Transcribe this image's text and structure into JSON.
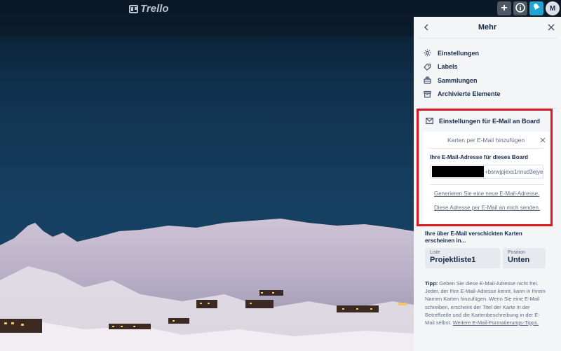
{
  "header": {
    "logo_text": "Trello",
    "avatar_initial": "M"
  },
  "panel": {
    "title": "Mehr",
    "menu": [
      {
        "label": "Einstellungen",
        "icon": "gear-icon"
      },
      {
        "label": "Labels",
        "icon": "label-icon"
      },
      {
        "label": "Sammlungen",
        "icon": "collections-icon"
      },
      {
        "label": "Archivierte Elemente",
        "icon": "archive-icon"
      }
    ],
    "email_section": {
      "heading": "Einstellungen für E-Mail an Board",
      "popover_title": "Karten per E-Mail hinzufügen",
      "address_label": "Ihre E-Mail-Adresse für dieses Board",
      "address_value": "+bsrwjpjexs1nnud3ejye",
      "generate_link": "Generieren Sie eine neue E-Mail-Adresse.",
      "send_link": "Diese Adresse per E-Mail an mich senden."
    },
    "appear_text": "Ihre über E-Mail verschickten Karten erscheinen in...",
    "list": {
      "label": "Liste",
      "value": "Projektliste1"
    },
    "position": {
      "label": "Position",
      "value": "Unten"
    },
    "tip": {
      "bold": "Tipp:",
      "text": " Geben Sie diese E-Mail-Adresse nicht frei. Jeder, der Ihre E-Mail-Adresse kennt, kann in Ihrem Namen Karten hinzufügen. Wenn Sie eine E-Mail schreiben, erscheint der Titel der Karte in der Betreffzeile und die Kartenbeschreibung in der E-Mail selbst. ",
      "link": "Weitere E-Mail-Formatierungs-Tipps."
    }
  }
}
